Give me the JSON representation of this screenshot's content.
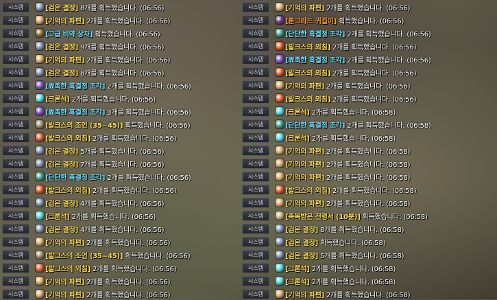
{
  "tag_label": "시스템",
  "colors": {
    "yellow": "#ffde5c",
    "cyan": "#74e3ff",
    "orange": "#ff9d2e",
    "blue": "#8fb6ff"
  },
  "icons": {
    "black-stone": "#7e8fb0",
    "memory-fragment": "#d9a767",
    "elixir-box": "#8a6a3c",
    "sharp-black-crystal": "#7b4fc4",
    "cron-stone": "#53d3e0",
    "advice-book": "#9a8b6a",
    "valks-cry": "#e05a2a",
    "hard-black-crystal": "#3aa08a",
    "tungrad-earring": "#6b3a8a",
    "scroll": "#c8b27a"
  },
  "left_rows": [
    {
      "icon": "black-stone",
      "item": "[검은 결정]",
      "color": "yellow",
      "text": " 8개를 획득했습니다. ",
      "time": "(06:56)"
    },
    {
      "icon": "memory-fragment",
      "item": "[기억의 파편]",
      "color": "yellow",
      "text": " 2개를 획득했습니다. ",
      "time": "(06:56)"
    },
    {
      "icon": "elixir-box",
      "item": "[고급 비약 상자]",
      "color": "cyan",
      "text": " 획득했습니다. ",
      "time": "(06:56)"
    },
    {
      "icon": "black-stone",
      "item": "[검은 결정]",
      "color": "yellow",
      "text": " 9개를 획득했습니다. ",
      "time": "(06:56)"
    },
    {
      "icon": "memory-fragment",
      "item": "[기억의 파편]",
      "color": "yellow",
      "text": " 2개를 획득했습니다. ",
      "time": "(06:56)"
    },
    {
      "icon": "black-stone",
      "item": "[검은 결정]",
      "color": "yellow",
      "text": " 8개를 획득했습니다. ",
      "time": "(06:56)"
    },
    {
      "icon": "sharp-black-crystal",
      "item": "[뾰족한 흑결정 조각]",
      "color": "cyan",
      "text": " 2개를 획득했습니다. ",
      "time": "(06:56)"
    },
    {
      "icon": "cron-stone",
      "item": "[크론석]",
      "color": "yellow",
      "text": " 2개를 획득했습니다. ",
      "time": "(06:56)"
    },
    {
      "icon": "sharp-black-crystal",
      "item": "[뾰족한 흑결정 조각]",
      "color": "cyan",
      "text": " 3개를 획득했습니다. ",
      "time": "(06:56)"
    },
    {
      "icon": "advice-book",
      "item": "[발크스의 조언 (35~45)]",
      "color": "yellow",
      "text": " 획득했습니다. ",
      "time": "(06:56)"
    },
    {
      "icon": "valks-cry",
      "item": "[발크스의 외침]",
      "color": "yellow",
      "text": " 2개를 획득했습니다. ",
      "time": "(06:56)"
    },
    {
      "icon": "black-stone",
      "item": "[검은 결정]",
      "color": "yellow",
      "text": " 5개를 획득했습니다. ",
      "time": "(06:56)"
    },
    {
      "icon": "black-stone",
      "item": "[검은 결정]",
      "color": "yellow",
      "text": " 7개를 획득했습니다. ",
      "time": "(06:56)"
    },
    {
      "icon": "hard-black-crystal",
      "item": "[단단한 흑결정 조각]",
      "color": "cyan",
      "text": " 2개를 획득했습니다. ",
      "time": "(06:56)"
    },
    {
      "icon": "valks-cry",
      "item": "[발크스의 외침]",
      "color": "yellow",
      "text": " 2개를 획득했습니다. ",
      "time": "(06:56)"
    },
    {
      "icon": "black-stone",
      "item": "[검은 결정]",
      "color": "yellow",
      "text": " 4개를 획득했습니다. ",
      "time": "(06:56)"
    },
    {
      "icon": "cron-stone",
      "item": "[크론석]",
      "color": "yellow",
      "text": " 2개를 획득했습니다. ",
      "time": "(06:56)"
    },
    {
      "icon": "black-stone",
      "item": "[검은 결정]",
      "color": "yellow",
      "text": " 4개를 획득했습니다. ",
      "time": "(06:56)"
    },
    {
      "icon": "memory-fragment",
      "item": "[기억의 파편]",
      "color": "yellow",
      "text": " 2개를 획득했습니다. ",
      "time": "(06:56)"
    },
    {
      "icon": "advice-book",
      "item": "[발크스의 조언 (35~45)]",
      "color": "yellow",
      "text": " 획득했습니다. ",
      "time": "(06:56)"
    },
    {
      "icon": "valks-cry",
      "item": "[발크스의 외침]",
      "color": "yellow",
      "text": " 2개를 획득했습니다. ",
      "time": "(06:56)"
    },
    {
      "icon": "memory-fragment",
      "item": "[기억의 파편]",
      "color": "yellow",
      "text": " 2개를 획득했습니다. ",
      "time": "(06:56)"
    },
    {
      "icon": "memory-fragment",
      "item": "[기억의 파편]",
      "color": "yellow",
      "text": " 2개를 획득했습니다. ",
      "time": "(06:56)"
    }
  ],
  "right_rows": [
    {
      "icon": "memory-fragment",
      "item": "[기억의 파편]",
      "color": "yellow",
      "text": " 2개를 획득했습니다. ",
      "time": "(06:56)"
    },
    {
      "icon": "tungrad-earring",
      "item": "[툰그라드 귀걸이]",
      "color": "orange",
      "text": " 획득했습니다. ",
      "time": "(06:56)"
    },
    {
      "icon": "hard-black-crystal",
      "item": "[단단한 흑결정 조각]",
      "color": "cyan",
      "text": " 2개를 획득했습니다. ",
      "time": "(06:56)"
    },
    {
      "icon": "valks-cry",
      "item": "[발크스의 외침]",
      "color": "yellow",
      "text": " 2개를 획득했습니다. ",
      "time": "(06:56)"
    },
    {
      "icon": "sharp-black-crystal",
      "item": "[뾰족한 흑결정 조각]",
      "color": "cyan",
      "text": " 2개를 획득했습니다. ",
      "time": "(06:56)"
    },
    {
      "icon": "valks-cry",
      "item": "[발크스의 외침]",
      "color": "yellow",
      "text": " 2개를 획득했습니다. ",
      "time": "(06:56)"
    },
    {
      "icon": "memory-fragment",
      "item": "[기억의 파편]",
      "color": "yellow",
      "text": " 2개를 획득했습니다. ",
      "time": "(06:56)"
    },
    {
      "icon": "valks-cry",
      "item": "[발크스의 외침]",
      "color": "yellow",
      "text": " 2개를 획득했습니다. ",
      "time": "(06:56)"
    },
    {
      "icon": "cron-stone",
      "item": "[크론석]",
      "color": "yellow",
      "text": " 2개를 획득했습니다. ",
      "time": "(06:58)"
    },
    {
      "icon": "hard-black-crystal",
      "item": "[단단한 흑결정 조각]",
      "color": "cyan",
      "text": " 2개를 획득했습니다. ",
      "time": "(06:58)"
    },
    {
      "icon": "cron-stone",
      "item": "[크론석]",
      "color": "yellow",
      "text": " 2개를 획득했습니다. ",
      "time": "(06:58)"
    },
    {
      "icon": "memory-fragment",
      "item": "[기억의 파편]",
      "color": "yellow",
      "text": " 2개를 획득했습니다. ",
      "time": "(06:58)"
    },
    {
      "icon": "memory-fragment",
      "item": "[기억의 파편]",
      "color": "yellow",
      "text": " 2개를 획득했습니다. ",
      "time": "(06:58)"
    },
    {
      "icon": "memory-fragment",
      "item": "[기억의 파편]",
      "color": "yellow",
      "text": " 2개를 획득했습니다. ",
      "time": "(06:58)"
    },
    {
      "icon": "valks-cry",
      "item": "[발크스의 외침]",
      "color": "yellow",
      "text": " 2개를 획득했습니다. ",
      "time": "(06:58)"
    },
    {
      "icon": "memory-fragment",
      "item": "[기억의 파편]",
      "color": "yellow",
      "text": " 2개를 획득했습니다. ",
      "time": "(06:58)"
    },
    {
      "icon": "scroll",
      "item": "[축복받은 전령서 (10분)]",
      "color": "yellow",
      "text": " 획득했습니다. ",
      "time": "(06:58)"
    },
    {
      "icon": "black-stone",
      "item": "[검은 결정]",
      "color": "yellow",
      "text": " 8개를 획득했습니다. ",
      "time": "(06:58)"
    },
    {
      "icon": "black-stone",
      "item": "[검은 결정]",
      "color": "yellow",
      "text": " 획득했습니다. ",
      "time": "(06:58)"
    },
    {
      "icon": "black-stone",
      "item": "[검은 결정]",
      "color": "yellow",
      "text": " 5개를 획득했습니다. ",
      "time": "(06:58)"
    },
    {
      "icon": "cron-stone",
      "item": "[크론석]",
      "color": "yellow",
      "text": " 2개를 획득했습니다. ",
      "time": "(06:58)"
    },
    {
      "icon": "cron-stone",
      "item": "[크론석]",
      "color": "yellow",
      "text": " 2개를 획득했습니다. ",
      "time": "(06:58)"
    },
    {
      "icon": "memory-fragment",
      "item": "[기억의 파편]",
      "color": "yellow",
      "text": " 2개를 획득했습니다. ",
      "time": "(06:58)"
    }
  ]
}
